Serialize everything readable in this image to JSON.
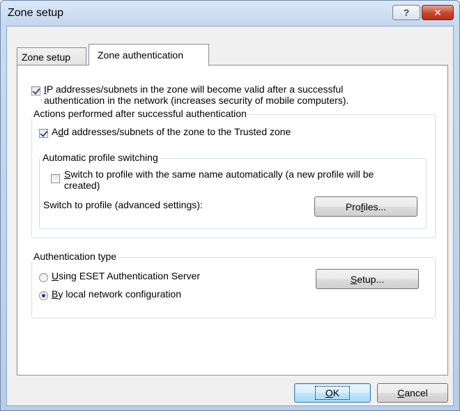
{
  "window": {
    "title": "Zone setup",
    "help_label": "?",
    "close_label": "✕"
  },
  "tabs": [
    {
      "label": "Zone setup",
      "active": false
    },
    {
      "label": "Zone authentication",
      "active": true
    }
  ],
  "zone_auth": {
    "ip_valid_checkbox": {
      "checked": true,
      "mnemonic": "I",
      "line1_rest": "P addresses/subnets in the zone will become valid after a successful",
      "line2": "authentication in the network (increases security of mobile computers)."
    },
    "actions_group": {
      "title": "Actions performed after successful authentication",
      "add_trusted_checkbox": {
        "checked": true,
        "pre": "A",
        "mnemonic": "d",
        "post": "d addresses/subnets of the zone to the Trusted zone"
      },
      "profile_group": {
        "title": "Automatic profile switching",
        "switch_checkbox": {
          "checked": false,
          "mnemonic": "S",
          "line1_rest": "witch to profile with the same name automatically (a new profile will be",
          "line2": "created)"
        },
        "advanced_label": "Switch to profile (advanced settings):",
        "profiles_button": {
          "pre": "Pro",
          "mnemonic": "f",
          "post": "iles..."
        }
      }
    },
    "auth_type_group": {
      "title": "Authentication type",
      "options": [
        {
          "mnemonic": "U",
          "rest": "sing ESET Authentication Server",
          "selected": false
        },
        {
          "mnemonic": "B",
          "rest": "y local network configuration",
          "selected": true
        }
      ],
      "setup_button": {
        "mnemonic": "S",
        "post": "etup..."
      }
    }
  },
  "footer": {
    "ok_button": {
      "mnemonic": "O",
      "post": "K"
    },
    "cancel_button": {
      "mnemonic": "C",
      "post": "ancel"
    }
  }
}
